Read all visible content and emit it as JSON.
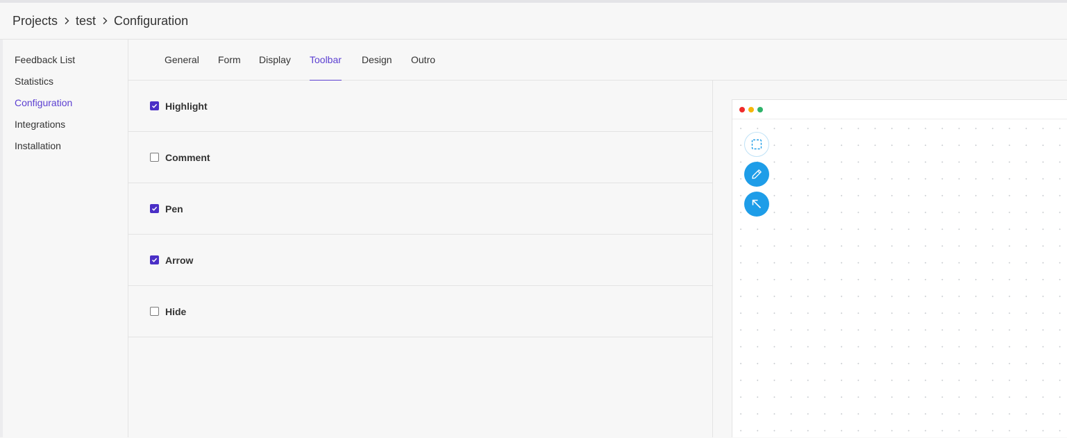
{
  "breadcrumb": {
    "items": [
      "Projects",
      "test",
      "Configuration"
    ]
  },
  "sidebar": {
    "items": [
      {
        "label": "Feedback List",
        "active": false
      },
      {
        "label": "Statistics",
        "active": false
      },
      {
        "label": "Configuration",
        "active": true
      },
      {
        "label": "Integrations",
        "active": false
      },
      {
        "label": "Installation",
        "active": false
      }
    ]
  },
  "tabs": {
    "items": [
      {
        "label": "General",
        "active": false
      },
      {
        "label": "Form",
        "active": false
      },
      {
        "label": "Display",
        "active": false
      },
      {
        "label": "Toolbar",
        "active": true
      },
      {
        "label": "Design",
        "active": false
      },
      {
        "label": "Outro",
        "active": false
      }
    ]
  },
  "toolbar_options": [
    {
      "label": "Highlight",
      "checked": true
    },
    {
      "label": "Comment",
      "checked": false
    },
    {
      "label": "Pen",
      "checked": true
    },
    {
      "label": "Arrow",
      "checked": true
    },
    {
      "label": "Hide",
      "checked": false
    }
  ],
  "preview": {
    "window_dots": [
      "red",
      "yellow",
      "green"
    ],
    "tools": [
      {
        "icon": "highlight-select-icon",
        "style": "outline"
      },
      {
        "icon": "pen-icon",
        "style": "filled"
      },
      {
        "icon": "arrow-icon",
        "style": "filled"
      }
    ]
  },
  "colors": {
    "accent": "#5b3fd1",
    "checkbox": "#4a2fc6",
    "tool_blue": "#1e9de8",
    "background": "#f7f7f7"
  }
}
